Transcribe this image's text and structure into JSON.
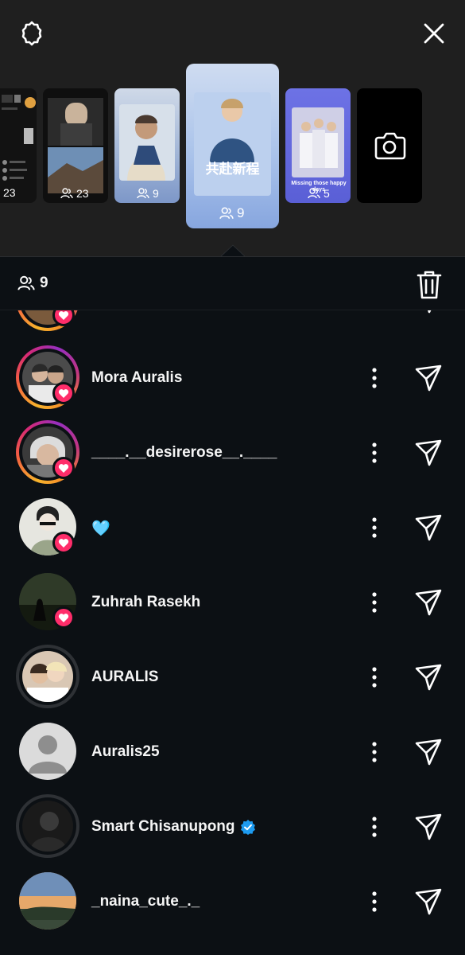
{
  "header": {
    "settings_icon": "gear-icon",
    "close_icon": "close-icon"
  },
  "stories": [
    {
      "id": "story-1",
      "views": "23"
    },
    {
      "id": "story-2",
      "views": "23"
    },
    {
      "id": "story-3",
      "views": "9"
    },
    {
      "id": "story-4",
      "views": "9",
      "selected": true,
      "caption_cjk": "共赴新程"
    },
    {
      "id": "story-5",
      "views": "5",
      "caption": "Missing those happy days"
    },
    {
      "id": "story-6",
      "icon": "camera-icon"
    }
  ],
  "viewers_bar": {
    "count": "9",
    "delete_icon": "trash-icon"
  },
  "viewers": [
    {
      "name": "",
      "ring": "story",
      "liked": true,
      "avatar_color": "#7a5a3c"
    },
    {
      "name": "Mora Auralis",
      "ring": "story",
      "liked": true,
      "avatar_color": "#4b4b4b"
    },
    {
      "name": "____.__desirerose__.____",
      "ring": "story",
      "liked": true,
      "avatar_color": "#3a3a3a"
    },
    {
      "name": "🩵",
      "ring": "none",
      "liked": true,
      "avatar_color": "#e6e6e0"
    },
    {
      "name": "Zuhrah Rasekh",
      "ring": "none",
      "liked": true,
      "avatar_color": "#1d2a18"
    },
    {
      "name": "AURALIS",
      "ring": "seen",
      "liked": false,
      "avatar_color": "#d9c7b4"
    },
    {
      "name": "Auralis25",
      "ring": "none",
      "liked": false,
      "avatar_color": "#dbdbdb"
    },
    {
      "name": "Smart Chisanupong",
      "ring": "seen",
      "liked": false,
      "verified": true,
      "avatar_color": "#1a1a1a"
    },
    {
      "name": "_naina_cute_._",
      "ring": "none",
      "liked": false,
      "avatar_color": "#c9a070"
    }
  ],
  "colors": {
    "accent_heart": "#ff2d6a",
    "verified": "#1d9bf0",
    "background": "#0c1014",
    "top_panel": "#1f1f1f"
  }
}
